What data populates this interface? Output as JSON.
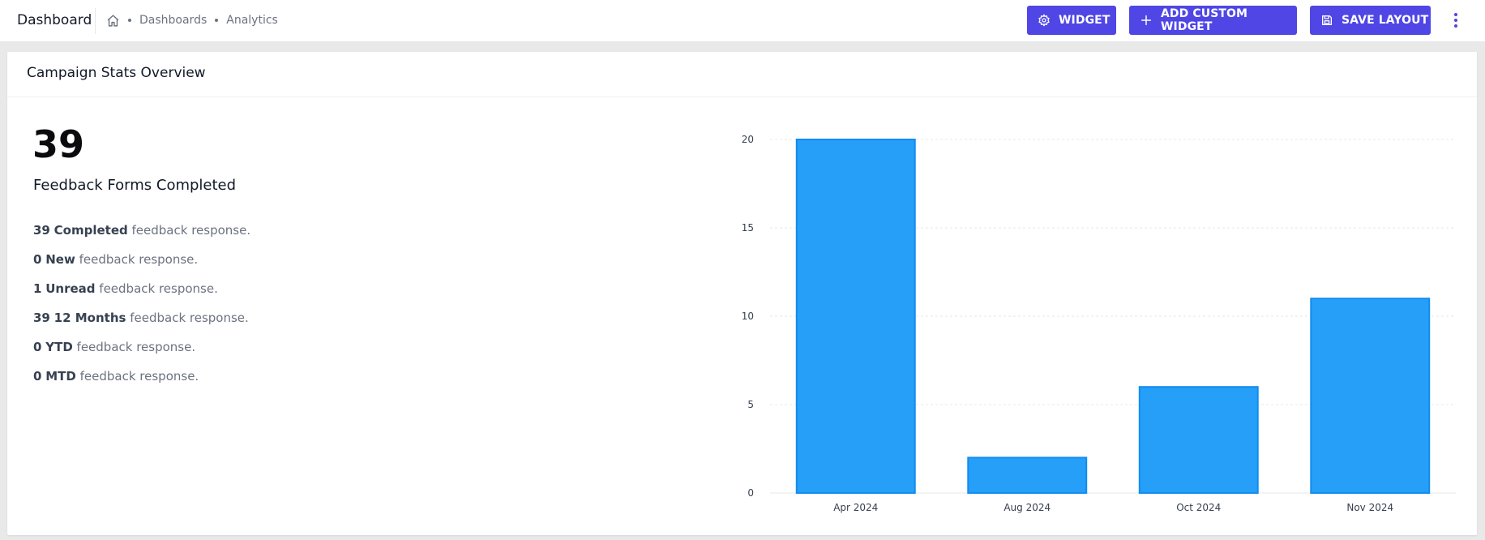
{
  "header": {
    "app_title": "Dashboard",
    "breadcrumb": [
      "Dashboards",
      "Analytics"
    ],
    "buttons": {
      "widget": "WIDGET",
      "add_custom_widget": "ADD CUSTOM WIDGET",
      "save_layout": "SAVE LAYOUT"
    },
    "accent_color": "#4f46e5"
  },
  "card": {
    "title": "Campaign Stats Overview",
    "big_number": "39",
    "big_label": "Feedback Forms Completed",
    "stats": [
      {
        "value": "39",
        "label": "Completed",
        "suffix": "feedback response."
      },
      {
        "value": "0",
        "label": "New",
        "suffix": "feedback response."
      },
      {
        "value": "1",
        "label": "Unread",
        "suffix": "feedback response."
      },
      {
        "value": "39",
        "label": "12 Months",
        "suffix": "feedback response."
      },
      {
        "value": "0",
        "label": "YTD",
        "suffix": "feedback response."
      },
      {
        "value": "0",
        "label": "MTD",
        "suffix": "feedback response."
      }
    ]
  },
  "chart_data": {
    "type": "bar",
    "categories": [
      "Apr 2024",
      "Aug 2024",
      "Oct 2024",
      "Nov 2024"
    ],
    "values": [
      20,
      2,
      6,
      11
    ],
    "ylim": [
      0,
      20
    ],
    "yticks": [
      0,
      5,
      10,
      15,
      20
    ],
    "grid": true,
    "bar_color": "#269ff8",
    "bar_border_color": "#128cf0"
  }
}
